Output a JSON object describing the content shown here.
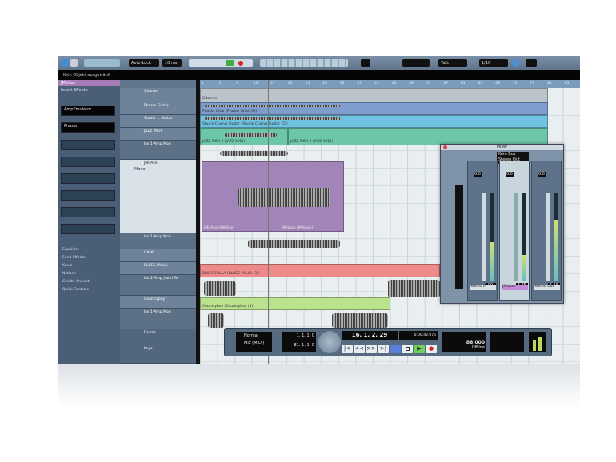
{
  "toolbar": {
    "automation_mode": "Auto-Lock",
    "auto_value": "10 ms",
    "snap_type": "Takt",
    "quantize": "1/16",
    "status": "Kein Objekt ausgewählt"
  },
  "inspector": {
    "track_name": "JMitAxe",
    "insert_label": "Insert-Effekte",
    "slots": [
      "AmpEmulator",
      "Phaser"
    ],
    "sections": [
      "Equalizer",
      "Send-Effekte",
      "Kanal",
      "Notizen",
      "Geräte-Ansicht",
      "Quick Controls"
    ]
  },
  "ruler": [
    "1",
    "5",
    "9",
    "13",
    "17",
    "21",
    "25",
    "29",
    "33",
    "37",
    "41",
    "45",
    "49",
    "53",
    "57",
    "61",
    "65",
    "69",
    "73",
    "77",
    "81",
    "85"
  ],
  "tracks": {
    "gitarren": "Gitarren",
    "phaser": "Phaser Guitar",
    "studio": "Studio ... Guitar",
    "jazz": "JAZZ MIDI",
    "ins1": "Ins.1-Amp Mod",
    "jmit": "JMitAxe",
    "gang": "GANG",
    "blues": "BLUES PALLA",
    "ins2": "Ins.1-Amp_Latin Te",
    "country": "Countryboy",
    "drums": "Drums",
    "keys": "Keys",
    "mode": "Mono"
  },
  "clips": {
    "gitarren": "Gitarren",
    "phaser": "Phaser Gitar (Phaser Gitar (9))",
    "studio": "Studio Chorus Guitar (Studio Chorus Guitar (5))",
    "jazz1": "JAZZ MIDI 3 (JAZZ MIDI)",
    "jazz2": "JAZZ MIDI 3 (JAZZ MIDI)",
    "jmit1": "JMitAxe (JMitAxe)",
    "jmit2": "JMitAxe (JMitAxe)",
    "blues": "BLUES PALLA (BLUES PALLA (3))",
    "country": "Countryboy (Countryboy (5))"
  },
  "mixer": {
    "title": "Mixer",
    "routing": [
      "Kein Bus",
      "Stereo Out"
    ],
    "strips": [
      {
        "name": "Stereo In",
        "pan": "0.0",
        "vol": "0.00",
        "level": 0.45
      },
      {
        "name": "JMitAxe",
        "pan": "0.0",
        "vol": "-4.75",
        "level": 0.3
      },
      {
        "name": "Stereo Out",
        "pan": "0.0",
        "vol": "-4.18",
        "level": 0.7
      }
    ]
  },
  "transport": {
    "mode": "Normal",
    "mix": "Mix (MIDI)",
    "left_locator": "1. 1. 1.   0",
    "right_locator": "81. 1. 1.   0",
    "position": "16. 1. 2. 29",
    "time": "0:00:42.075",
    "tempo": "86.000",
    "sync": "Offline",
    "buttons": [
      "|<",
      "<<",
      ">>",
      ">|",
      "loop",
      "stop",
      "play",
      "rec"
    ]
  }
}
